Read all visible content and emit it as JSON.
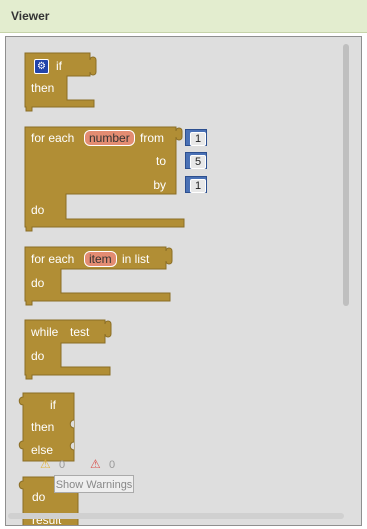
{
  "panel": {
    "title": "Viewer"
  },
  "blocks": {
    "if_then": {
      "if_label": "if",
      "then_label": "then"
    },
    "for_range": {
      "for_each_label": "for each",
      "var_name": "number",
      "from_label": "from",
      "to_label": "to",
      "by_label": "by",
      "do_label": "do",
      "from_value": "1",
      "to_value": "5",
      "by_value": "1"
    },
    "for_list": {
      "for_each_label": "for each",
      "var_name": "item",
      "in_list_label": "in list",
      "do_label": "do"
    },
    "while": {
      "while_label": "while",
      "test_label": "test",
      "do_label": "do"
    },
    "if_else": {
      "if_label": "if",
      "then_label": "then",
      "else_label": "else"
    },
    "do_result": {
      "do_label": "do",
      "result_label": "result"
    }
  },
  "warnings": {
    "warning_count": "0",
    "error_count": "0",
    "toggle_label": "Show Warnings"
  },
  "colors": {
    "control_block": "#b18e35",
    "number_block": "#4a71b5",
    "variable_pill": "#e38c72"
  }
}
